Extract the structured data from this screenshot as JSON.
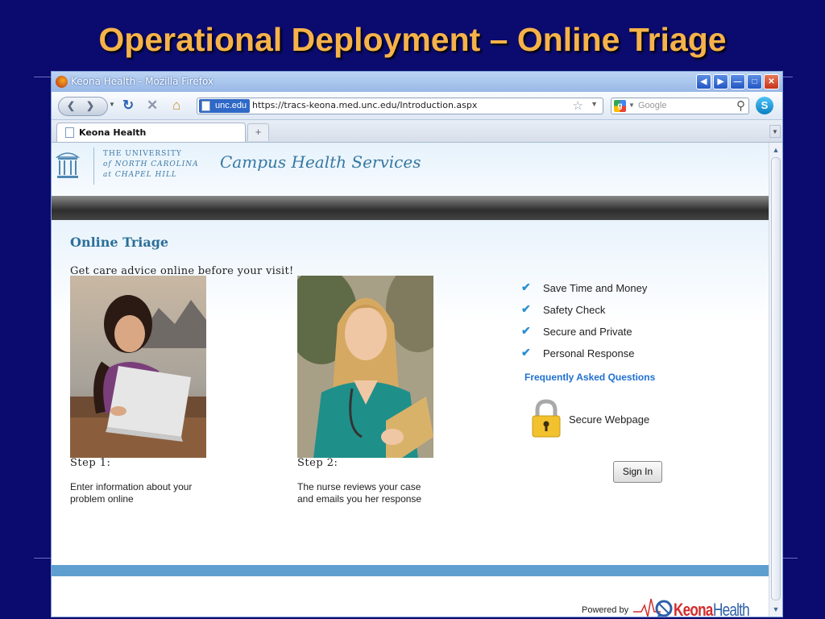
{
  "slide": {
    "title": "Operational Deployment – Online Triage"
  },
  "browser": {
    "window_title": "Keona Health - Mozilla Firefox",
    "url_domain": "unc.edu",
    "url": "https://tracs-keona.med.unc.edu/Introduction.aspx",
    "search_placeholder": "Google",
    "tab_label": "Keona Health",
    "new_tab_label": "+"
  },
  "header": {
    "university_line1": "THE UNIVERSITY",
    "university_line2": "of NORTH CAROLINA",
    "university_line3": "at CHAPEL HILL",
    "site_title": "Campus Health Services"
  },
  "main": {
    "heading": "Online Triage",
    "subheading": "Get care advice online before your visit!",
    "steps": [
      {
        "title": "Step 1:",
        "description": "Enter information about your problem online",
        "image": "woman-with-laptop-photo"
      },
      {
        "title": "Step 2:",
        "description": "The nurse reviews your case and emails you her response",
        "image": "nurse-photo"
      }
    ],
    "benefits": [
      "Save Time and Money",
      "Safety Check",
      "Secure and Private",
      "Personal Response"
    ],
    "faq_link": "Frequently Asked Questions",
    "secure_label": "Secure Webpage",
    "sign_in_label": "Sign In"
  },
  "footer": {
    "powered_by": "Powered by",
    "logo_text_1": "Keona",
    "logo_text_2": "Health"
  },
  "colors": {
    "slide_background": "#0b0a6e",
    "slide_title": "#f6b24a",
    "link_blue": "#1f6fd0",
    "heading_blue": "#2a6f9a",
    "footer_bar": "#5e9fd0",
    "logo_red": "#d32c2c"
  }
}
